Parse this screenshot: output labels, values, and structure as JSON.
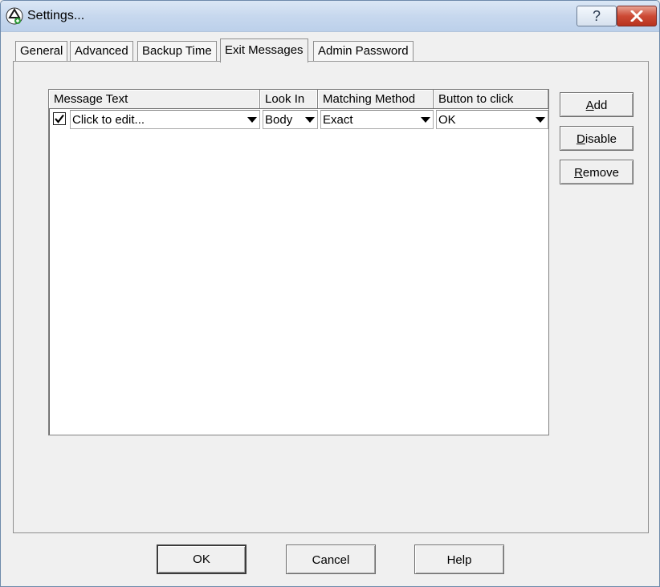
{
  "window": {
    "title": "Settings...",
    "help_label": "?"
  },
  "tabs": [
    {
      "label": "General"
    },
    {
      "label": "Advanced"
    },
    {
      "label": "Backup Time"
    },
    {
      "label": "Exit Messages",
      "active": true
    },
    {
      "label": "Admin Password"
    }
  ],
  "grid": {
    "columns": [
      "Message Text",
      "Look In",
      "Matching Method",
      "Button to click"
    ],
    "rows": [
      {
        "checked": true,
        "message_text": "Click to edit...",
        "look_in": "Body",
        "matching_method": "Exact",
        "button_to_click": "OK"
      }
    ]
  },
  "side_buttons": {
    "add": {
      "accel": "A",
      "rest": "dd"
    },
    "disable": {
      "accel": "D",
      "rest": "isable"
    },
    "remove": {
      "accel": "R",
      "rest": "emove"
    }
  },
  "bottom_buttons": {
    "ok": "OK",
    "cancel": "Cancel",
    "help": "Help"
  }
}
